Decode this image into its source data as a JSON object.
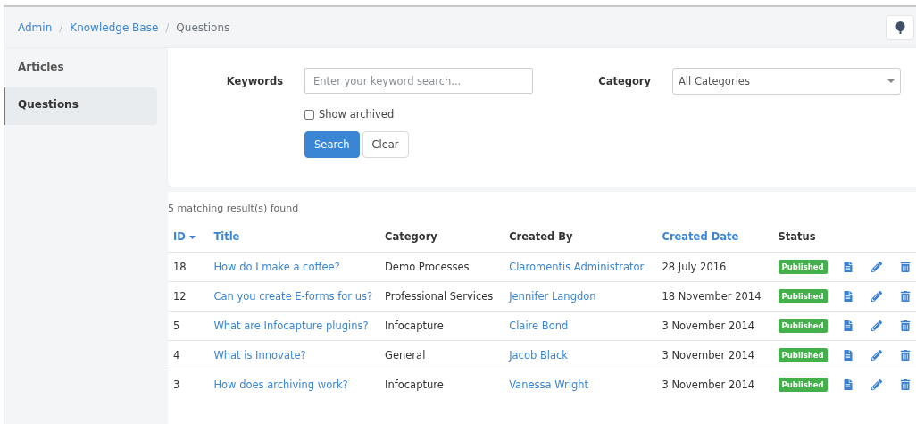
{
  "breadcrumb": {
    "separator": "/",
    "items": [
      {
        "label": "Admin",
        "link": true
      },
      {
        "label": "Knowledge Base",
        "link": true
      },
      {
        "label": "Questions",
        "link": false
      }
    ]
  },
  "sidebar": {
    "items": [
      {
        "label": "Articles",
        "selected": false
      },
      {
        "label": "Questions",
        "selected": true
      }
    ]
  },
  "search_form": {
    "keywords_label": "Keywords",
    "keywords_placeholder": "Enter your keyword search...",
    "category_label": "Category",
    "category_value": "All Categories",
    "show_archived": {
      "label": "Show archived",
      "checked": false
    },
    "buttons": [
      {
        "label": "Search",
        "kind": "primary"
      },
      {
        "label": "Clear",
        "kind": "secondary"
      }
    ]
  },
  "result_count": "5 matching result(s) found",
  "table": {
    "columns": [
      {
        "label": "ID",
        "sortable": true,
        "sorted": true
      },
      {
        "label": "Title",
        "sortable": true,
        "sorted": false
      },
      {
        "label": "Category",
        "sortable": false,
        "sorted": false
      },
      {
        "label": "Created By",
        "sortable": false,
        "sorted": false
      },
      {
        "label": "Created Date",
        "sortable": true,
        "sorted": false
      },
      {
        "label": "Status",
        "sortable": false,
        "sorted": false
      }
    ],
    "rows": [
      {
        "id": "18",
        "title": "How do I make a coffee?",
        "category": "Demo Processes",
        "created_by": "Claromentis Administrator",
        "created_date": "28 July 2016",
        "status": "Published"
      },
      {
        "id": "12",
        "title": "Can you create E-forms for us?",
        "category": "Professional Services",
        "created_by": "Jennifer Langdon",
        "created_date": "18 November 2014",
        "status": "Published"
      },
      {
        "id": "5",
        "title": "What are Infocapture plugins?",
        "category": "Infocapture",
        "created_by": "Claire Bond",
        "created_date": "3 November 2014",
        "status": "Published"
      },
      {
        "id": "4",
        "title": "What is Innovate?",
        "category": "General",
        "created_by": "Jacob Black",
        "created_date": "3 November 2014",
        "status": "Published"
      },
      {
        "id": "3",
        "title": "How does archiving work?",
        "category": "Infocapture",
        "created_by": "Vanessa Wright",
        "created_date": "3 November 2014",
        "status": "Published"
      }
    ]
  }
}
